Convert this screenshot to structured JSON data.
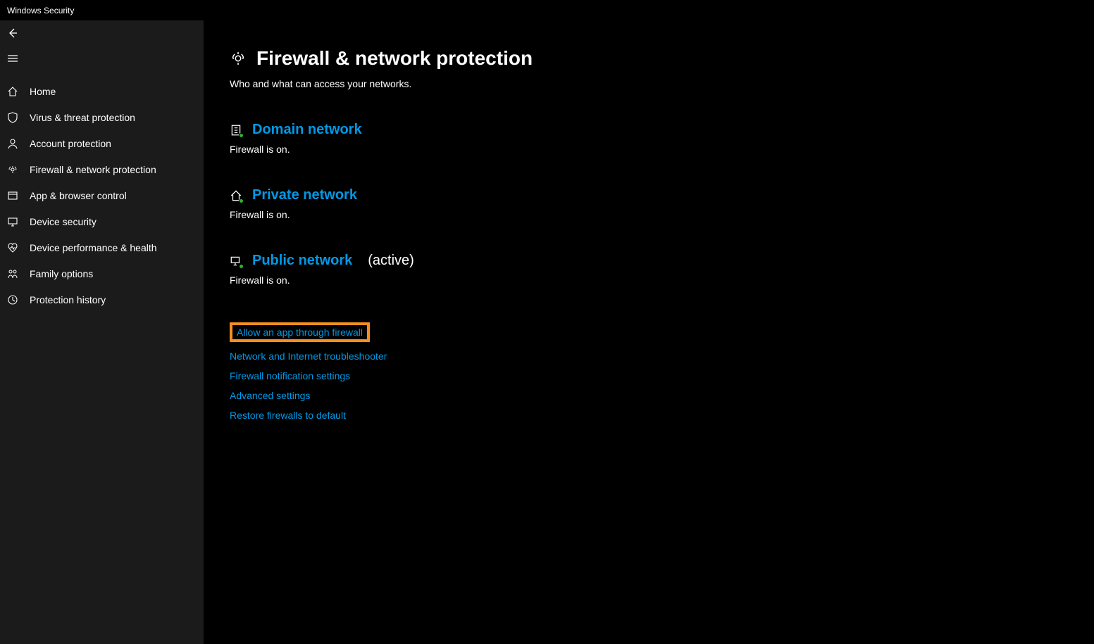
{
  "window": {
    "title": "Windows Security"
  },
  "sidebar": {
    "items": [
      {
        "label": "Home"
      },
      {
        "label": "Virus & threat protection"
      },
      {
        "label": "Account protection"
      },
      {
        "label": "Firewall & network protection"
      },
      {
        "label": "App & browser control"
      },
      {
        "label": "Device security"
      },
      {
        "label": "Device performance & health"
      },
      {
        "label": "Family options"
      },
      {
        "label": "Protection history"
      }
    ]
  },
  "page": {
    "title": "Firewall & network protection",
    "subtitle": "Who and what can access your networks."
  },
  "networks": {
    "domain": {
      "label": "Domain network",
      "status": "Firewall is on.",
      "suffix": ""
    },
    "private": {
      "label": "Private network",
      "status": "Firewall is on.",
      "suffix": ""
    },
    "public": {
      "label": "Public network",
      "status": "Firewall is on.",
      "suffix": "(active)"
    }
  },
  "links": [
    "Allow an app through firewall",
    "Network and Internet troubleshooter",
    "Firewall notification settings",
    "Advanced settings",
    "Restore firewalls to default"
  ]
}
